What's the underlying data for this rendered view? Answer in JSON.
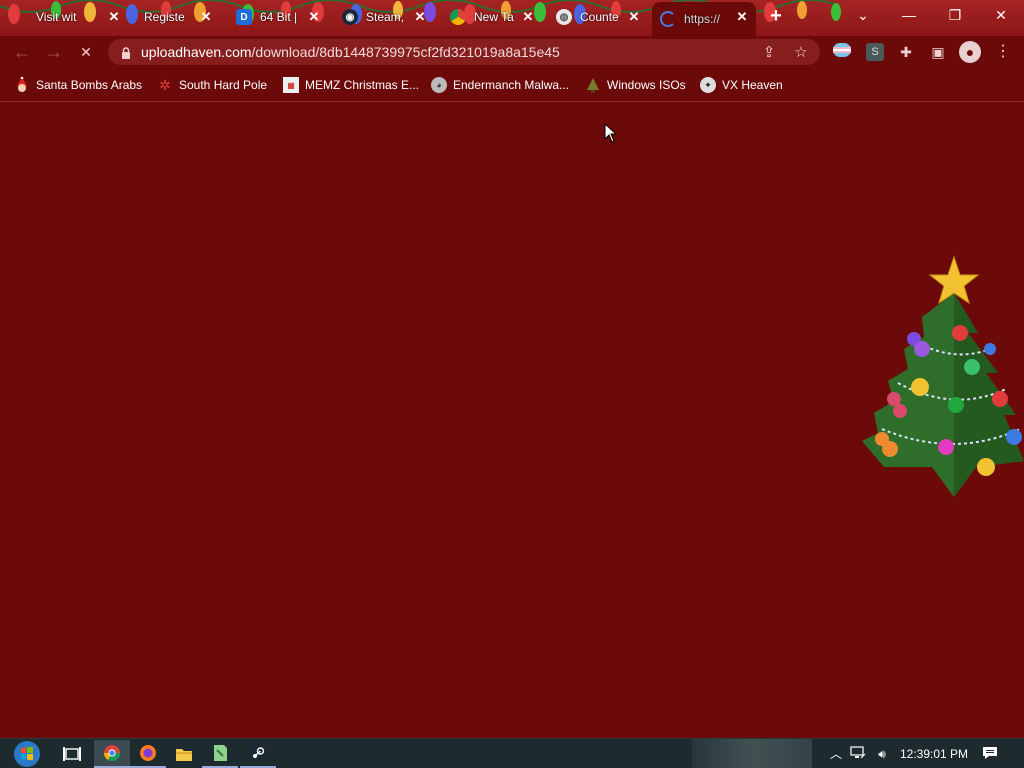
{
  "browser": {
    "tabs": [
      {
        "title": "Visit wit",
        "favicon": "christmas-bulb-icon"
      },
      {
        "title": "Registe",
        "favicon": "christmas-bulb-icon"
      },
      {
        "title": "64 Bit |",
        "favicon": "blue-page-icon"
      },
      {
        "title": "Steam,",
        "favicon": "steam-icon"
      },
      {
        "title": "New Ta",
        "favicon": "chrome-icon"
      },
      {
        "title": "Counte",
        "favicon": "globe-icon"
      },
      {
        "title": "https://",
        "favicon": "loading-icon",
        "active": true
      }
    ],
    "url_host": "uploadhaven.com",
    "url_path": "/download/8db1448739975cf2fd321019a8a15e45",
    "profile_letter": "S"
  },
  "bookmarks": [
    {
      "label": "Santa Bombs Arabs",
      "icon": "santa-icon"
    },
    {
      "label": "South Hard Pole",
      "icon": "snowflake-icon"
    },
    {
      "label": "MEMZ Christmas E...",
      "icon": "memz-icon"
    },
    {
      "label": "Endermanch Malwa...",
      "icon": "raccoon-icon"
    },
    {
      "label": "Windows ISOs",
      "icon": "tree-person-icon"
    },
    {
      "label": "VX Heaven",
      "icon": "vx-icon"
    }
  ],
  "taskbar": {
    "clock": "12:39:01 PM",
    "apps": [
      "start-button",
      "task-view",
      "chrome",
      "firefox",
      "file-explorer",
      "notepad-plus-plus",
      "steam"
    ]
  },
  "colors": {
    "page_bg": "#6c0a09",
    "tab_strip": "#8e1616",
    "omnibox": "#871e1e",
    "taskbar": "#1d2a2e"
  }
}
